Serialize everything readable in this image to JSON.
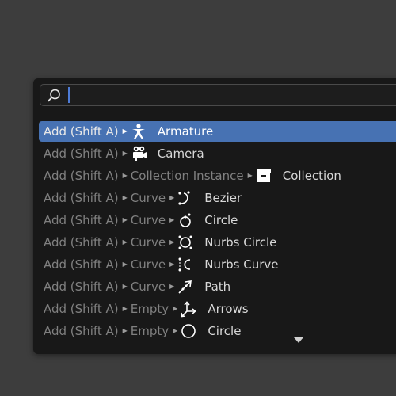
{
  "search": {
    "value": "",
    "placeholder": ""
  },
  "items": [
    {
      "path": [
        "Add (Shift A)"
      ],
      "icon": "armature-icon",
      "label": "Armature",
      "selected": true
    },
    {
      "path": [
        "Add (Shift A)"
      ],
      "icon": "camera-icon",
      "label": "Camera"
    },
    {
      "path": [
        "Add (Shift A)",
        "Collection Instance"
      ],
      "icon": "collection-icon",
      "label": "Collection"
    },
    {
      "path": [
        "Add (Shift A)",
        "Curve"
      ],
      "icon": "bezier-curve-icon",
      "label": "Bezier"
    },
    {
      "path": [
        "Add (Shift A)",
        "Curve"
      ],
      "icon": "curve-circle-icon",
      "label": "Circle"
    },
    {
      "path": [
        "Add (Shift A)",
        "Curve"
      ],
      "icon": "nurbs-circle-icon",
      "label": "Nurbs Circle"
    },
    {
      "path": [
        "Add (Shift A)",
        "Curve"
      ],
      "icon": "nurbs-curve-icon",
      "label": "Nurbs Curve"
    },
    {
      "path": [
        "Add (Shift A)",
        "Curve"
      ],
      "icon": "path-icon",
      "label": "Path"
    },
    {
      "path": [
        "Add (Shift A)",
        "Empty"
      ],
      "icon": "arrows-icon",
      "label": "Arrows"
    },
    {
      "path": [
        "Add (Shift A)",
        "Empty"
      ],
      "icon": "empty-circle-icon",
      "label": "Circle"
    }
  ],
  "colors": {
    "selection": "#4772b3",
    "menu_bg": "#181818",
    "viewport_bg": "#3d3d3d",
    "caret": "#4d7bd6"
  }
}
